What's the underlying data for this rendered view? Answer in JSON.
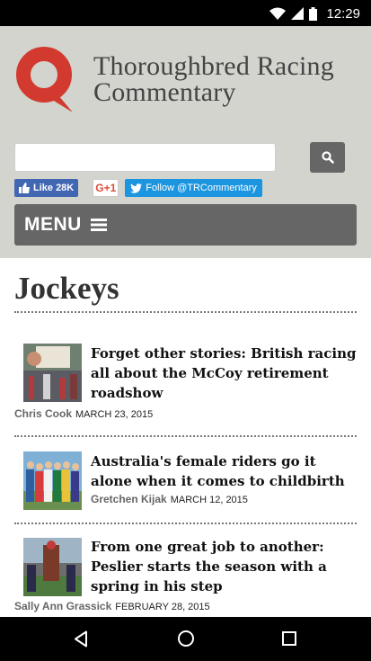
{
  "status": {
    "time": "12:29"
  },
  "header": {
    "brand_line1": "Thoroughbred Racing",
    "brand_line2": "Commentary",
    "search_placeholder": "",
    "fb_like_label": "Like 28K",
    "gplus_label": "G+1",
    "twitter_label": "Follow @TRCommentary",
    "menu_label": "MENU"
  },
  "main": {
    "page_title": "Jockeys",
    "articles": [
      {
        "title": "Forget other stories: British racing all about the McCoy retirement roadshow",
        "author": "Chris Cook",
        "date": "MARCH 23, 2015"
      },
      {
        "title": "Australia's female riders go it alone when it comes to childbirth",
        "author": "Gretchen Kijak",
        "date": "MARCH 12, 2015"
      },
      {
        "title": "From one great job to another: Peslier starts the season with a spring in his step",
        "author": "Sally Ann Grassick",
        "date": "FEBRUARY 28, 2015"
      }
    ]
  },
  "colors": {
    "logo_red": "#d23a2f",
    "header_bg": "#d2d4cd",
    "menu_bg": "#666666",
    "facebook": "#4267b2",
    "twitter": "#1b95e0"
  }
}
